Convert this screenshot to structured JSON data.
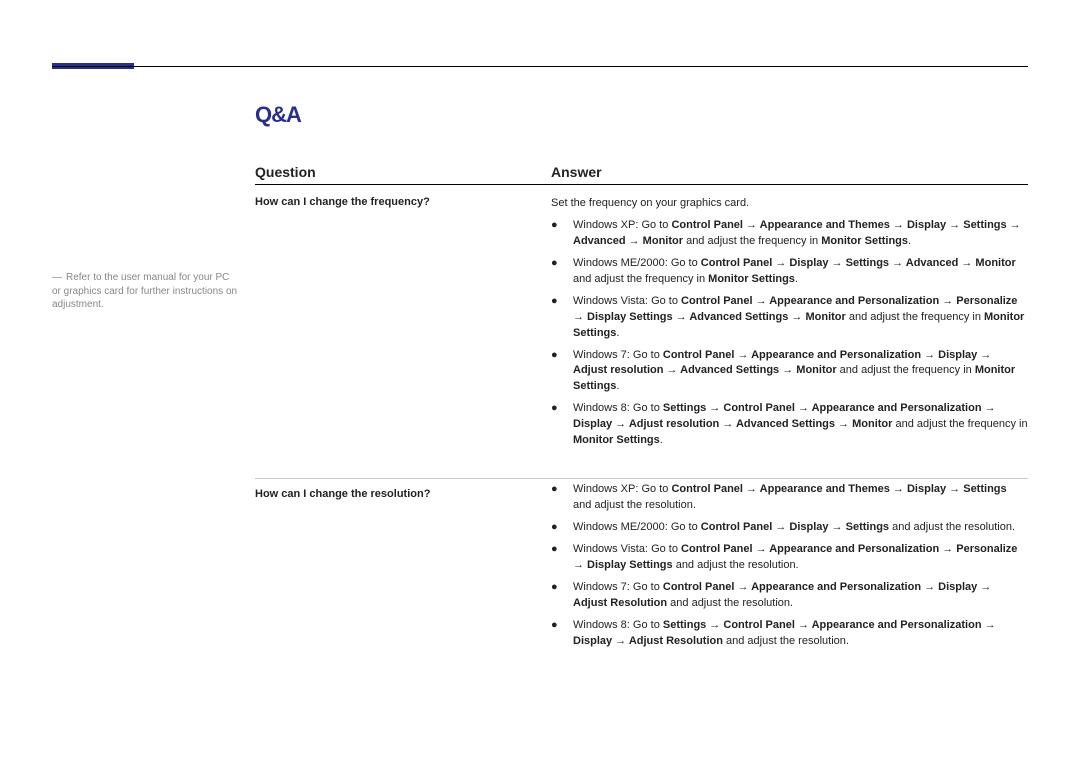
{
  "qa_title": "Q&A",
  "headers": {
    "question": "Question",
    "answer": "Answer"
  },
  "sidenote": "Refer to the user manual for your PC or graphics card for further instructions on adjustment.",
  "q1": {
    "question": "How can I change the frequency?",
    "intro": "Set the frequency on your graphics card.",
    "items": [
      {
        "os": "Windows XP:",
        "pre": "Go to ",
        "path": "Control Panel → Appearance and Themes → Display → Settings → Advanced → Monitor",
        "mid": " and adjust the frequency in ",
        "end": "Monitor Settings",
        "tail": "."
      },
      {
        "os": "Windows ME/2000:",
        "pre": "Go to ",
        "path": "Control Panel → Display → Settings → Advanced → Monitor",
        "mid": " and adjust the frequency in ",
        "end": "Monitor Settings",
        "tail": "."
      },
      {
        "os": "Windows Vista:",
        "pre": "Go to ",
        "path": "Control Panel → Appearance and Personalization → Personalize → Display Settings → Advanced Settings → Monitor",
        "mid": " and adjust the frequency in ",
        "end": "Monitor Settings",
        "tail": "."
      },
      {
        "os": "Windows 7:",
        "pre": "Go to ",
        "path": "Control Panel → Appearance and Personalization → Display → Adjust resolution → Advanced Settings → Monitor",
        "mid": " and adjust the frequency in ",
        "end": "Monitor Settings",
        "tail": "."
      },
      {
        "os": "Windows 8:",
        "pre": "Go to ",
        "path": "Settings → Control Panel → Appearance and Personalization → Display → Adjust resolution → Advanced Settings → Monitor",
        "mid": " and adjust the frequency in ",
        "end": "Monitor Settings",
        "tail": "."
      }
    ]
  },
  "q2": {
    "question": "How can I change the resolution?",
    "items": [
      {
        "os": "Windows XP:",
        "pre": "Go to ",
        "path": "Control Panel → Appearance and Themes → Display → Settings",
        "mid": " and adjust the resolution.",
        "end": "",
        "tail": ""
      },
      {
        "os": "Windows ME/2000:",
        "pre": "Go to ",
        "path": "Control Panel → Display → Settings",
        "mid": " and adjust the resolution.",
        "end": "",
        "tail": ""
      },
      {
        "os": "Windows Vista:",
        "pre": "Go to ",
        "path": "Control Panel → Appearance and Personalization → Personalize → Display Settings",
        "mid": " and adjust the resolution.",
        "end": "",
        "tail": ""
      },
      {
        "os": "Windows 7:",
        "pre": "Go to ",
        "path": "Control Panel → Appearance and Personalization → Display → Adjust Resolution",
        "mid": " and adjust the resolution.",
        "end": "",
        "tail": ""
      },
      {
        "os": "Windows 8:",
        "pre": "Go to ",
        "path": "Settings → Control Panel → Appearance and Personalization → Display → Adjust Resolution",
        "mid": " and adjust the resolution.",
        "end": "",
        "tail": ""
      }
    ]
  }
}
